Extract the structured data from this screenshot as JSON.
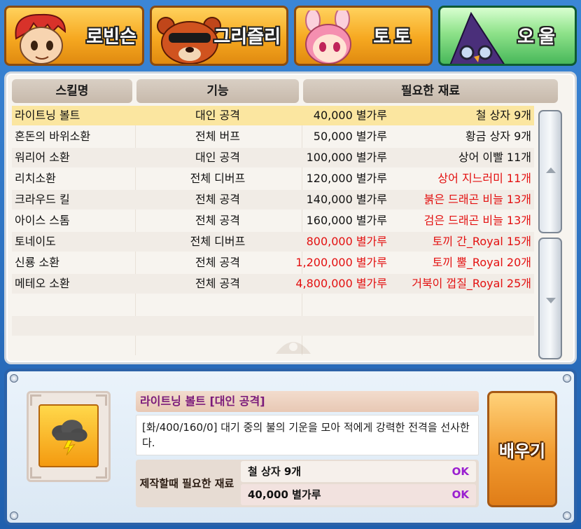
{
  "tabs": [
    {
      "label": "로빈슨",
      "icon": "robinson-portrait-icon"
    },
    {
      "label": "그리즐리",
      "icon": "grizzly-portrait-icon"
    },
    {
      "label": "토토",
      "icon": "toto-portrait-icon"
    },
    {
      "label": "오울",
      "icon": "owl-portrait-icon"
    }
  ],
  "table": {
    "headers": [
      "스킬명",
      "기능",
      "필요한 재료"
    ],
    "rows": [
      {
        "name": "라이트닝 볼트",
        "function": "대인 공격",
        "powder": "40,000 별가루",
        "material": "철 상자 9개",
        "powder_red": false,
        "material_red": false
      },
      {
        "name": "혼돈의 바위소환",
        "function": "전체 버프",
        "powder": "50,000 별가루",
        "material": "황금 상자 9개",
        "powder_red": false,
        "material_red": false
      },
      {
        "name": "워리어 소환",
        "function": "대인 공격",
        "powder": "100,000 별가루",
        "material": "상어 이빨 11개",
        "powder_red": false,
        "material_red": false
      },
      {
        "name": "리치소환",
        "function": "전체 디버프",
        "powder": "120,000 별가루",
        "material": "상어 지느러미 11개",
        "powder_red": false,
        "material_red": true
      },
      {
        "name": "크라우드 킬",
        "function": "전체 공격",
        "powder": "140,000 별가루",
        "material": "붉은 드래곤 비늘 13개",
        "powder_red": false,
        "material_red": true
      },
      {
        "name": "아이스 스톰",
        "function": "전체 공격",
        "powder": "160,000 별가루",
        "material": "검은 드래곤 비늘 13개",
        "powder_red": false,
        "material_red": true
      },
      {
        "name": "토네이도",
        "function": "전체 디버프",
        "powder": "800,000 별가루",
        "material": "토끼 간_Royal 15개",
        "powder_red": true,
        "material_red": true
      },
      {
        "name": "신룡 소환",
        "function": "전체 공격",
        "powder": "1,200,000 별가루",
        "material": "토끼 뿔_Royal 20개",
        "powder_red": true,
        "material_red": true
      },
      {
        "name": "메테오 소환",
        "function": "전체 공격",
        "powder": "4,800,000 별가루",
        "material": "거북이 껍질_Royal 25개",
        "powder_red": true,
        "material_red": true
      }
    ],
    "selected_index": 0
  },
  "detail": {
    "title": "라이트닝 볼트 [대인 공격]",
    "description": "[화/400/160/0] 대기 중의 불의 기운을 모아 적에게 강력한 전격을 선사한다.",
    "req_label": "제작할때 필요한 재료",
    "requirements": [
      {
        "text": "철 상자 9개",
        "status": "OK"
      },
      {
        "text": "40,000 별가루",
        "status": "OK"
      }
    ],
    "skill_icon": "storm-cloud-icon",
    "learn_label": "배우기"
  },
  "colors": {
    "selected_row": "#fbe6a0",
    "missing_text": "#e31010",
    "ok_text": "#9a1fd0"
  }
}
